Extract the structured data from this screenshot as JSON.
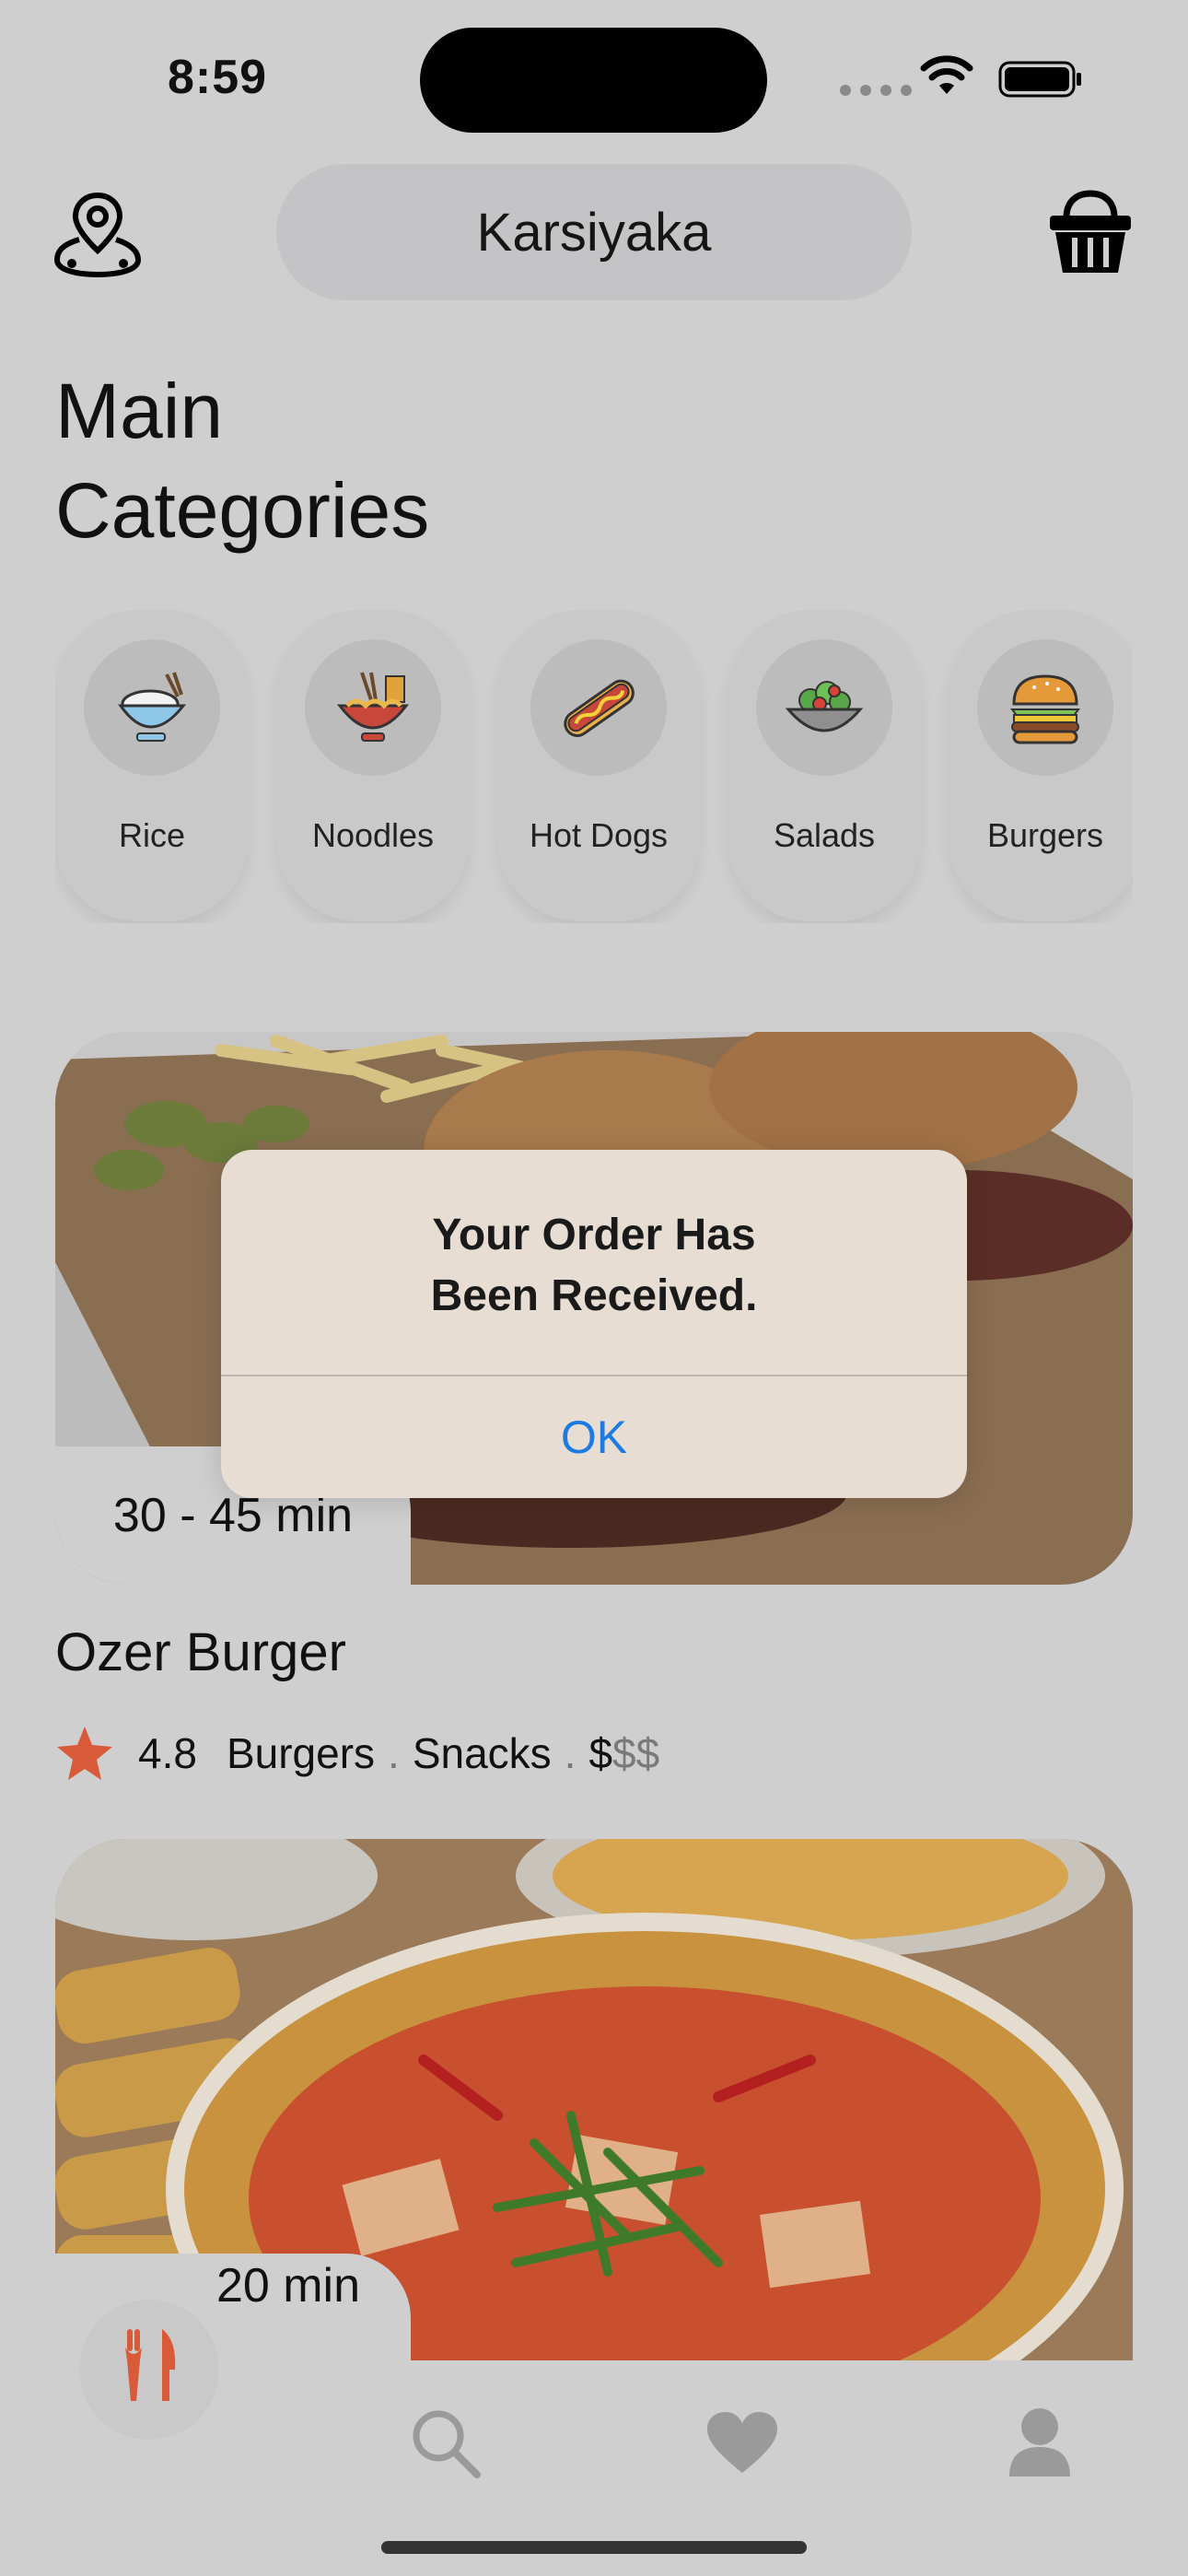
{
  "status_bar": {
    "time": "8:59"
  },
  "header": {
    "location": "Karsiyaka"
  },
  "main": {
    "title_line1": "Main",
    "title_line2": "Categories",
    "categories": [
      {
        "label": "Rice",
        "icon": "rice-bowl-icon"
      },
      {
        "label": "Noodles",
        "icon": "noodles-icon"
      },
      {
        "label": "Hot Dogs",
        "icon": "hot-dog-icon"
      },
      {
        "label": "Salads",
        "icon": "salad-icon"
      },
      {
        "label": "Burgers",
        "icon": "burger-icon"
      }
    ],
    "restaurants": [
      {
        "name": "Ozer Burger",
        "delivery_time": "30 - 45 min",
        "rating": "4.8",
        "tag1": "Burgers",
        "tag2": "Snacks",
        "price_active": "$",
        "price_inactive": "$$",
        "separator": "."
      },
      {
        "delivery_time": "20 min"
      }
    ]
  },
  "dialog": {
    "title": "Your Order Has\nBeen Received.",
    "ok_label": "OK"
  },
  "tabbar": {
    "tabs": [
      "restaurants-tab",
      "search-tab",
      "favorites-tab",
      "profile-tab"
    ]
  },
  "colors": {
    "accent": "#d85a38",
    "link": "#1c7ae0"
  }
}
